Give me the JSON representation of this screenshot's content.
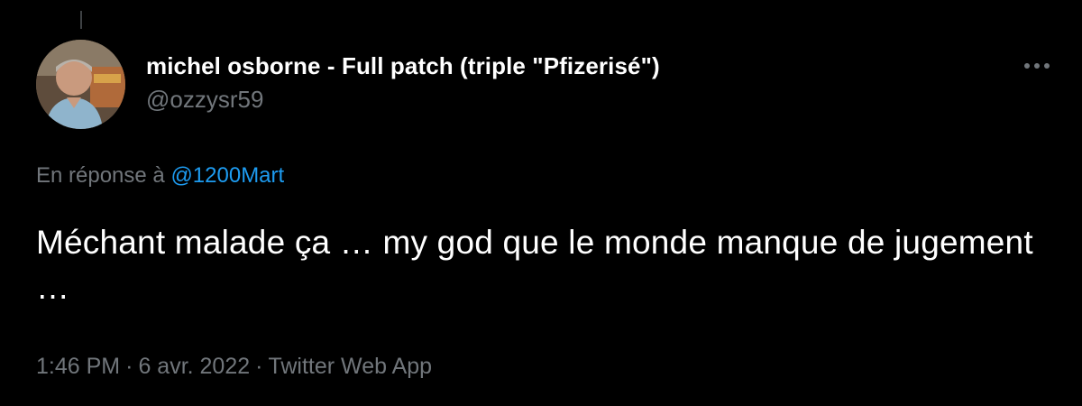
{
  "author": {
    "display_name": "michel osborne - Full patch (triple \"Pfizerisé\")",
    "handle": "@ozzysr59"
  },
  "reply": {
    "prefix": "En réponse à ",
    "mention": "@1200Mart"
  },
  "tweet": {
    "text": "Méchant malade ça … my god que le monde manque de jugement …"
  },
  "meta": {
    "time": "1:46 PM",
    "separator": "·",
    "date": "6 avr. 2022",
    "source": "Twitter Web App"
  },
  "icons": {
    "more": "more-horizontal-icon"
  },
  "colors": {
    "background": "#000000",
    "primary_text": "#ffffff",
    "secondary_text": "#71767b",
    "link": "#1d9bf0"
  }
}
